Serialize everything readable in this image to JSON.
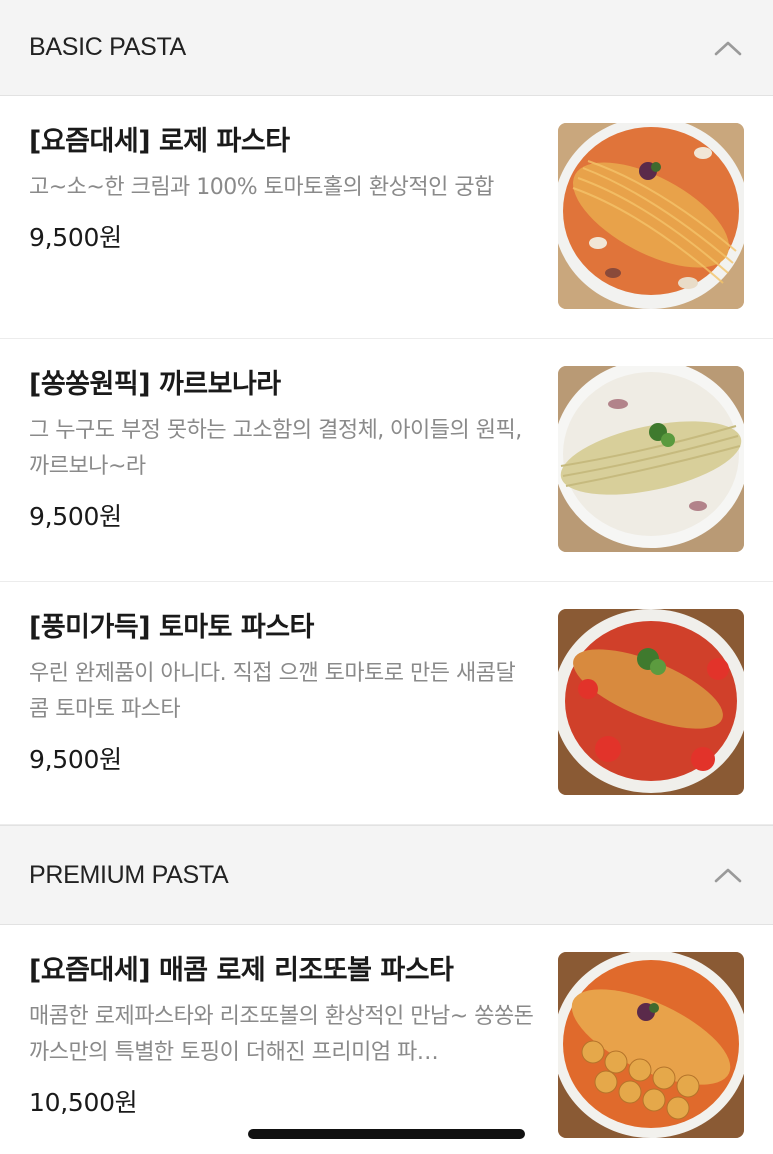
{
  "sections": [
    {
      "title": "BASIC PASTA",
      "items": [
        {
          "name": "[요즘대세] 로제 파스타",
          "desc": "고~소~한 크림과 100% 토마토홀의 환상적인 궁합",
          "price": "9,500원",
          "image": "rose-pasta"
        },
        {
          "name": "[쏭쏭원픽] 까르보나라",
          "desc": "그 누구도 부정 못하는 고소함의 결정체, 아이들의 원픽, 까르보나~라",
          "price": "9,500원",
          "image": "carbonara"
        },
        {
          "name": "[풍미가득] 토마토 파스타",
          "desc": "우린 완제품이 아니다. 직접 으깬 토마토로 만든 새콤달콤 토마토 파스타",
          "price": "9,500원",
          "image": "tomato-pasta"
        }
      ]
    },
    {
      "title": "PREMIUM PASTA",
      "items": [
        {
          "name": "[요즘대세] 매콤 로제 리조또볼 파스타",
          "desc": "매콤한 로제파스타와 리조또볼의 환상적인 만남~ 쏭쏭돈까스만의 특별한 토핑이 더해진 프리미엄 파…",
          "price": "10,500원",
          "image": "spicy-rose-risotto-ball-pasta"
        }
      ]
    }
  ],
  "icons": {
    "collapse": "chevron-up-icon"
  },
  "colors": {
    "header_bg": "#f4f4f4",
    "desc": "#8a8a8a",
    "title": "#1a1a1a"
  }
}
